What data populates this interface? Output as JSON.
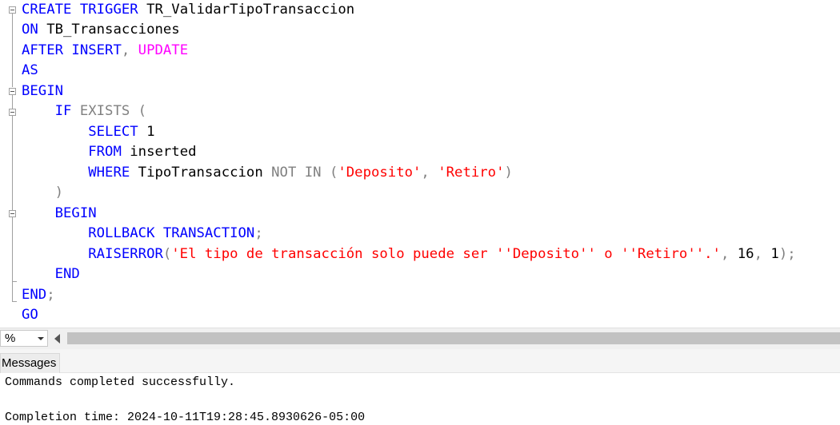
{
  "editor": {
    "line1": {
      "kw": "CREATE TRIGGER",
      "name": " TR_ValidarTipoTransaccion"
    },
    "line2": {
      "kw": "ON",
      "name": " TB_Transacciones"
    },
    "line3": {
      "kw1": "AFTER INSERT",
      "comma": ",",
      "fn": " UPDATE"
    },
    "line4": {
      "kw": "AS"
    },
    "line5": {
      "kw": "BEGIN"
    },
    "line6": {
      "indent": "    ",
      "kw": "IF",
      "gr": " EXISTS ("
    },
    "line7": {
      "indent": "        ",
      "kw": "SELECT",
      "tx": " 1"
    },
    "line8": {
      "indent": "        ",
      "kw": "FROM",
      "tx": " inserted"
    },
    "line9": {
      "indent": "        ",
      "kw": "WHERE",
      "tx": " TipoTransaccion ",
      "gr1": "NOT IN (",
      "st1": "'Deposito'",
      "gr2": ", ",
      "st2": "'Retiro'",
      "gr3": ")"
    },
    "line10": {
      "indent": "    ",
      "gr": ")"
    },
    "line11": {
      "indent": "    ",
      "kw": "BEGIN"
    },
    "line12": {
      "indent": "        ",
      "kw": "ROLLBACK TRANSACTION",
      "gr": ";"
    },
    "line13": {
      "indent": "        ",
      "kw": "RAISERROR",
      "gr1": "(",
      "st": "'El tipo de transacción solo puede ser ''Deposito'' o ''Retiro''.'",
      "gr2": ", ",
      "n1": "16",
      "gr3": ", ",
      "n2": "1",
      "gr4": ");"
    },
    "line14": {
      "indent": "    ",
      "kw": "END"
    },
    "line15": {
      "kw": "END",
      "gr": ";"
    },
    "line16": {
      "kw": "GO"
    }
  },
  "toolbar": {
    "zoom_value": "%"
  },
  "results": {
    "tab_label": "Messages",
    "line1": "Commands completed successfully.",
    "line2": "Completion time: 2024-10-11T19:28:45.8930626-05:00"
  },
  "colors": {
    "keyword": "#0000ff",
    "function": "#ff00ff",
    "operator": "#808080",
    "string": "#ff0000",
    "text": "#000000"
  }
}
